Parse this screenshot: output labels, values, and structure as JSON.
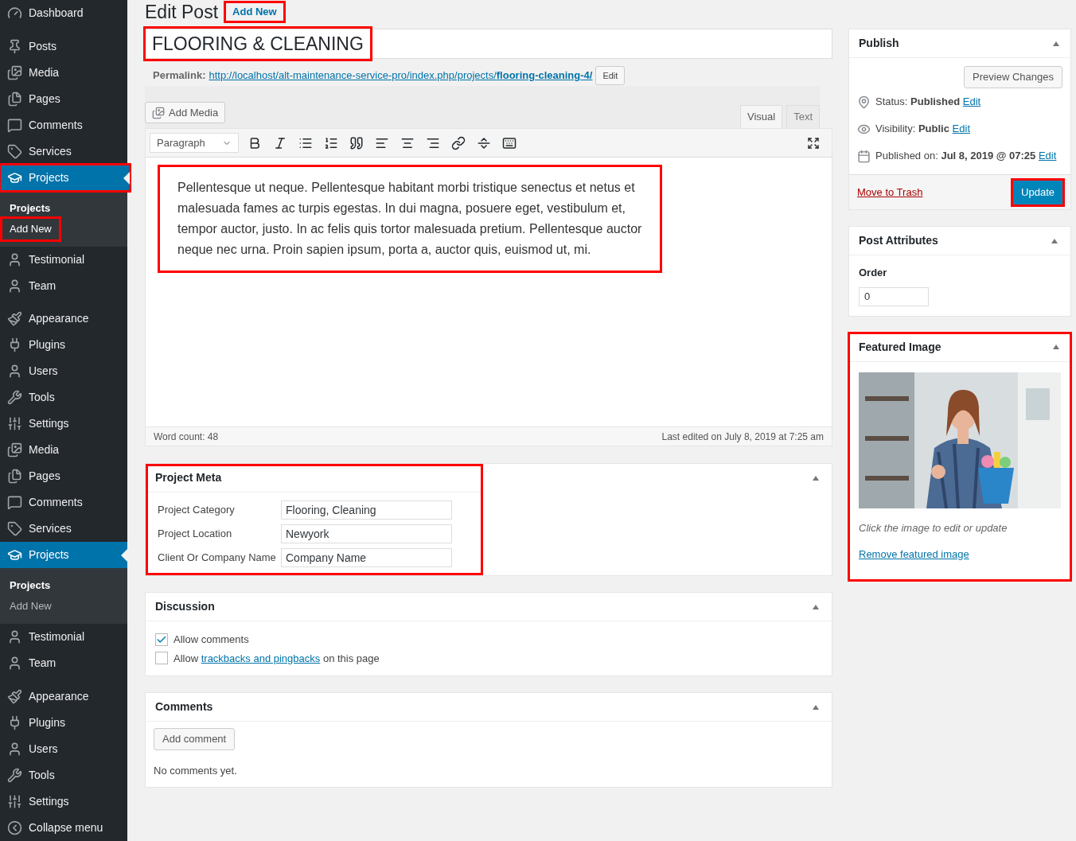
{
  "sidebar": {
    "items": [
      {
        "kind": "item",
        "label": "Dashboard",
        "selected": false,
        "highlighted": false
      },
      {
        "kind": "separator"
      },
      {
        "kind": "item",
        "label": "Posts",
        "selected": false,
        "highlighted": false
      },
      {
        "kind": "item",
        "label": "Media",
        "selected": false,
        "highlighted": false
      },
      {
        "kind": "item",
        "label": "Pages",
        "selected": false,
        "highlighted": false
      },
      {
        "kind": "item",
        "label": "Comments",
        "selected": false,
        "highlighted": false
      },
      {
        "kind": "item",
        "label": "Services",
        "selected": false,
        "highlighted": false
      },
      {
        "kind": "item",
        "label": "Projects",
        "selected": true,
        "highlighted": true
      },
      {
        "kind": "submenu",
        "title": "Projects",
        "items": [
          {
            "label": "Add New",
            "highlighted": true
          }
        ]
      },
      {
        "kind": "item",
        "label": "Testimonial",
        "selected": false,
        "highlighted": false
      },
      {
        "kind": "item",
        "label": "Team",
        "selected": false,
        "highlighted": false
      },
      {
        "kind": "separator"
      },
      {
        "kind": "item",
        "label": "Appearance",
        "selected": false,
        "highlighted": false
      },
      {
        "kind": "item",
        "label": "Plugins",
        "selected": false,
        "highlighted": false
      },
      {
        "kind": "item",
        "label": "Users",
        "selected": false,
        "highlighted": false
      },
      {
        "kind": "item",
        "label": "Tools",
        "selected": false,
        "highlighted": false
      },
      {
        "kind": "item",
        "label": "Settings",
        "selected": false,
        "highlighted": false
      },
      {
        "kind": "item",
        "label": "Media",
        "selected": false,
        "highlighted": false
      },
      {
        "kind": "item",
        "label": "Pages",
        "selected": false,
        "highlighted": false
      },
      {
        "kind": "item",
        "label": "Comments",
        "selected": false,
        "highlighted": false
      },
      {
        "kind": "item",
        "label": "Services",
        "selected": false,
        "highlighted": false
      },
      {
        "kind": "item",
        "label": "Projects",
        "selected": true,
        "highlighted": false
      },
      {
        "kind": "submenu",
        "title": "Projects",
        "items": [
          {
            "label": "Add New",
            "highlighted": false
          }
        ]
      },
      {
        "kind": "item",
        "label": "Testimonial",
        "selected": false,
        "highlighted": false
      },
      {
        "kind": "item",
        "label": "Team",
        "selected": false,
        "highlighted": false
      },
      {
        "kind": "separator"
      },
      {
        "kind": "item",
        "label": "Appearance",
        "selected": false,
        "highlighted": false
      },
      {
        "kind": "item",
        "label": "Plugins",
        "selected": false,
        "highlighted": false
      },
      {
        "kind": "item",
        "label": "Users",
        "selected": false,
        "highlighted": false
      },
      {
        "kind": "item",
        "label": "Tools",
        "selected": false,
        "highlighted": false
      },
      {
        "kind": "item",
        "label": "Settings",
        "selected": false,
        "highlighted": false
      },
      {
        "kind": "collapse",
        "label": "Collapse menu"
      }
    ]
  },
  "header": {
    "title": "Edit Post",
    "add_new": {
      "label": "Add New",
      "highlighted": true
    }
  },
  "post_title": {
    "value": "FLOORING & CLEANING",
    "highlighted": true
  },
  "permalink": {
    "label": "Permalink:",
    "url": "http://localhost/alt-maintenance-service-pro/index.php/projects/**flooring-cleaning-4/**",
    "edit_button": "Edit"
  },
  "editor": {
    "add_media": "Add Media",
    "tabs": [
      {
        "label": "Visual",
        "selected": true
      },
      {
        "label": "Text",
        "selected": false
      }
    ],
    "format": "Paragraph",
    "content": "Pellentesque ut neque. Pellentesque habitant morbi tristique senectus et netus et malesuada fames ac turpis egestas. In dui magna, posuere eget, vestibulum et, tempor auctor, justo. In ac felis quis tortor malesuada pretium. Pellentesque auctor neque nec urna. Proin sapien ipsum, porta a, auctor quis, euismod ut, mi.",
    "content_highlighted": true,
    "word_count": "Word count: 48",
    "last_edited": "Last edited on July 8, 2019 at 7:25 am"
  },
  "project_meta": {
    "title": "Project Meta",
    "highlighted": true,
    "fields": [
      {
        "label": "Project Category",
        "value": "Flooring, Cleaning"
      },
      {
        "label": "Project Location",
        "value": "Newyork"
      },
      {
        "label": "Client Or Company Name",
        "value": "Company Name"
      }
    ]
  },
  "discussion": {
    "title": "Discussion",
    "options": [
      {
        "kind": "plain",
        "label": "Allow comments",
        "checked": true
      },
      {
        "kind": "link",
        "before": "Allow",
        "link": "trackbacks and pingbacks",
        "after": "on this page",
        "checked": false
      }
    ]
  },
  "comments": {
    "title": "Comments",
    "button": "Add comment",
    "empty": "No comments yet."
  },
  "publish": {
    "title": "Publish",
    "preview": "Preview Changes",
    "rows": [
      {
        "text": "Status: **Published**",
        "edit": "Edit"
      },
      {
        "text": "Visibility: **Public**",
        "edit": "Edit"
      },
      {
        "text": "Published on: **Jul 8, 2019 @ 07:25**",
        "edit": "Edit"
      }
    ],
    "trash": "Move to Trash",
    "update": {
      "label": "Update",
      "highlighted": true
    }
  },
  "post_attributes": {
    "title": "Post Attributes",
    "order_label": "Order",
    "order_value": "0"
  },
  "featured_image": {
    "title": "Featured Image",
    "highlighted": true,
    "hint": "Click the image to edit or update",
    "remove": "Remove featured image"
  }
}
